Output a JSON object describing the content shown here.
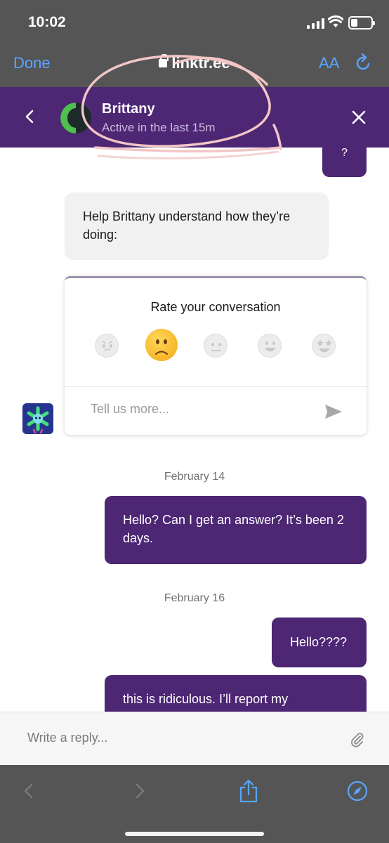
{
  "status_bar": {
    "time": "10:02"
  },
  "browser": {
    "done_label": "Done",
    "url": "linktr.ee",
    "text_size_label": "AA"
  },
  "chat_header": {
    "name": "Brittany",
    "status": "Active in the last 15m"
  },
  "messages": {
    "partial_outgoing": "?",
    "incoming": "Help Brittany understand how they’re doing:",
    "rating": {
      "title": "Rate your conversation",
      "selected_index": 1,
      "faces": [
        "angry-face-icon",
        "frowning-face-icon",
        "neutral-face-icon",
        "smiling-face-icon",
        "star-struck-face-icon"
      ],
      "placeholder": "Tell us more..."
    },
    "date_1": "February 14",
    "out_1": "Hello? Can I get an answer? It’s been 2 days.",
    "date_2": "February 16",
    "out_2": "Hello????",
    "out_3": "this is ridiculous. I’ll report my"
  },
  "reply": {
    "placeholder": "Write a reply..."
  },
  "colors": {
    "brand_purple": "#4d2674",
    "safari_gray": "#555555",
    "link_blue": "#58a6ff",
    "annotation_pink": "#f2c6c6"
  }
}
